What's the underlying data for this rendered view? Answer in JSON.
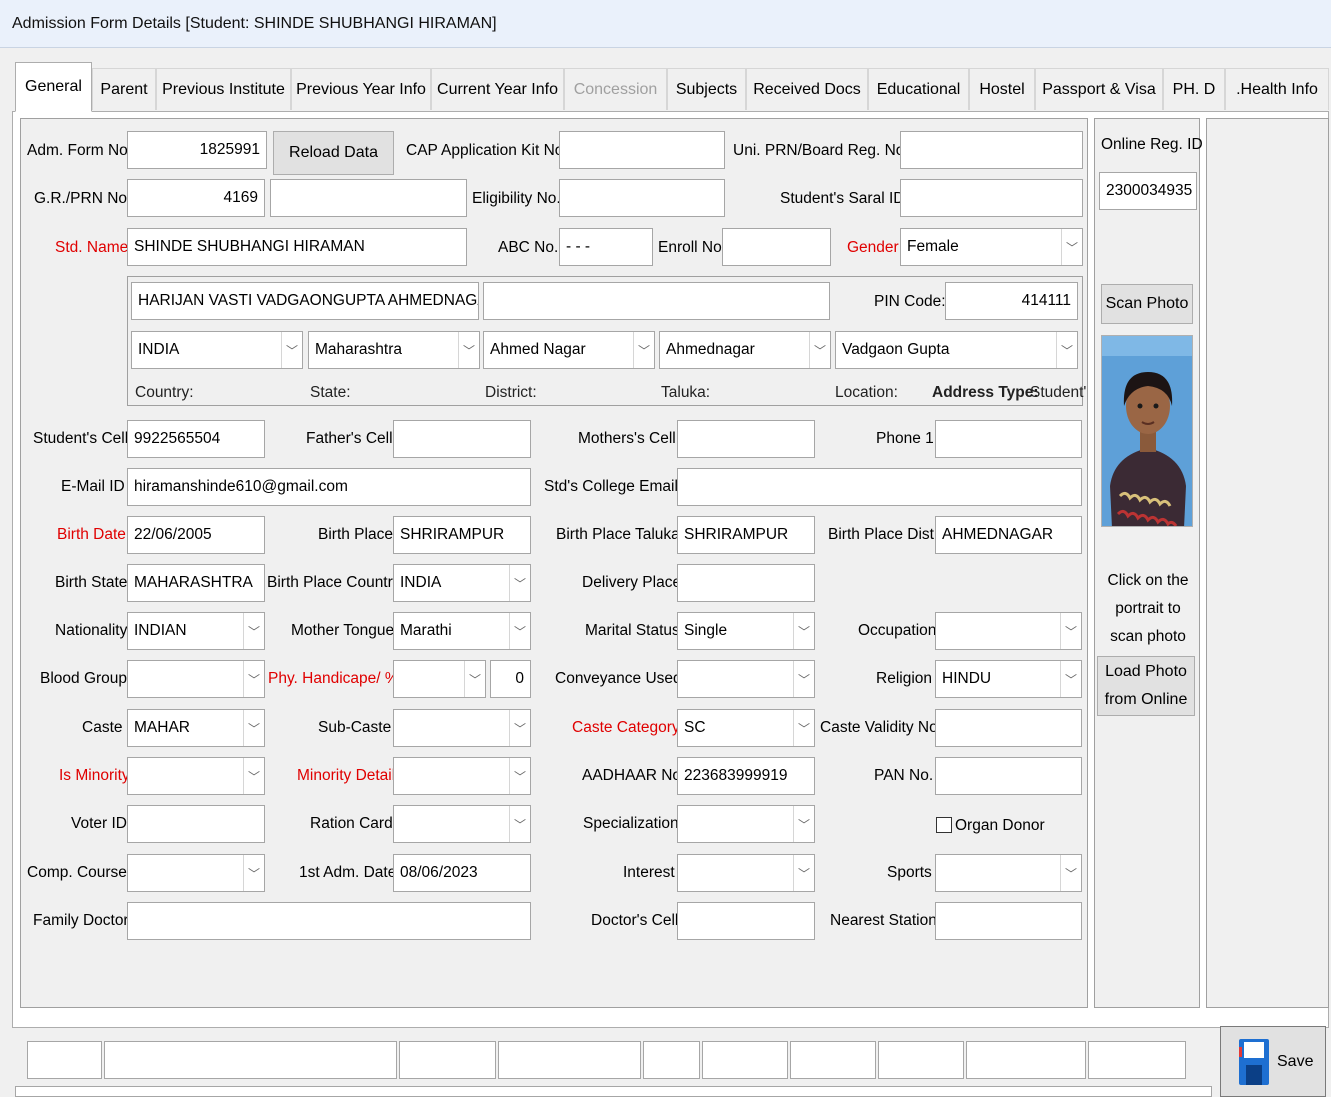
{
  "window": {
    "title": "Admission Form Details [Student: SHINDE SHUBHANGI HIRAMAN]"
  },
  "tabs": [
    {
      "label": "General"
    },
    {
      "label": "Parent"
    },
    {
      "label": "Previous Institute"
    },
    {
      "label": "Previous Year Info"
    },
    {
      "label": "Current Year Info"
    },
    {
      "label": "Concession"
    },
    {
      "label": "Subjects"
    },
    {
      "label": "Received Docs"
    },
    {
      "label": "Educational"
    },
    {
      "label": "Hostel"
    },
    {
      "label": "Passport & Visa"
    },
    {
      "label": "PH. D"
    },
    {
      "label": ".Health Info"
    }
  ],
  "labels": {
    "adm_form_no": "Adm. Form No.",
    "cap_kit": "CAP Application Kit No.",
    "uni_prn": "Uni. PRN/Board Reg. No.",
    "gr_prn": "G.R./PRN No.",
    "eligibility": "Eligibility No.",
    "saral_id": "Student's Saral ID",
    "std_name": "Std. Name",
    "abc_no": "ABC No.",
    "enroll_no": "Enroll No.",
    "gender": "Gender",
    "pin_code": "PIN Code:",
    "country": "Country:",
    "state": "State:",
    "district": "District:",
    "taluka": "Taluka:",
    "location": "Location:",
    "address_type_label": "Address Type:",
    "students_cell": "Student's Cell",
    "fathers_cell": "Father's Cell",
    "mothers_cell": "Mothers's Cell",
    "phone1": "Phone 1",
    "email": "E-Mail ID",
    "college_email": "Std's College Email",
    "birth_date": "Birth Date",
    "birth_place": "Birth Place",
    "birth_place_taluka": "Birth Place Taluka",
    "birth_place_dist": "Birth Place Dist.",
    "birth_state": "Birth State",
    "birth_place_country": "Birth Place Country",
    "delivery_place": "Delivery Place",
    "nationality": "Nationality",
    "mother_tongue": "Mother Tongue",
    "marital_status": "Marital Status",
    "occupation": "Occupation",
    "blood_group": "Blood Group",
    "phy_handicap": "Phy. Handicape/ %",
    "conveyance": "Conveyance Used",
    "religion": "Religion",
    "caste": "Caste",
    "sub_caste": "Sub-Caste",
    "caste_category": "Caste Category",
    "caste_validity": "Caste Validity No.",
    "is_minority": "Is Minority",
    "minority_detail": "Minority Detail",
    "aadhaar": "AADHAAR No.",
    "pan": "PAN No.",
    "voter_id": "Voter ID",
    "ration_card": "Ration Card",
    "specialization": "Specialization",
    "organ_donor": "Organ Donor",
    "comp_course": "Comp. Course",
    "first_adm_date": "1st Adm. Date",
    "interest": "Interest",
    "sports": "Sports",
    "family_doctor": "Family Doctor",
    "doctors_cell": "Doctor's Cell",
    "nearest_station": "Nearest Station",
    "online_reg_id": "Online Reg. ID",
    "scan_hint": "Click on the portrait to scan photo"
  },
  "values": {
    "adm_form_no": "1825991",
    "gr_prn": "4169",
    "std_name": "SHINDE SHUBHANGI HIRAMAN",
    "abc_no": "- - -",
    "gender": "Female",
    "address_line": "HARIJAN VASTI VADGAONGUPTA  AHMEDNAGAR",
    "pin_code": "414111",
    "country": "INDIA",
    "state": "Maharashtra",
    "district": "Ahmed Nagar",
    "taluka": "Ahmednagar",
    "location": "Vadgaon Gupta",
    "address_type": "Student'",
    "students_cell": "9922565504",
    "email": "hiramanshinde610@gmail.com",
    "birth_date": "22/06/2005",
    "birth_place": "SHRIRAMPUR",
    "birth_place_taluka": "SHRIRAMPUR",
    "birth_place_dist": "AHMEDNAGAR",
    "birth_state": "MAHARASHTRA",
    "birth_place_country": "INDIA",
    "nationality": "INDIAN",
    "mother_tongue": "Marathi",
    "marital_status": "Single",
    "phy_handicap_pct": "0",
    "religion": "HINDU",
    "caste": "MAHAR",
    "caste_category": "SC",
    "aadhaar": "223683999919",
    "first_adm_date": "08/06/2023",
    "online_reg_id": "2300034935"
  },
  "buttons": {
    "reload": "Reload Data",
    "scan_photo": "Scan Photo",
    "load_photo": "Load Photo from Online",
    "save": "Save"
  },
  "colors": {
    "required_label": "#e00000",
    "save_icon": "#1e6fd1"
  }
}
